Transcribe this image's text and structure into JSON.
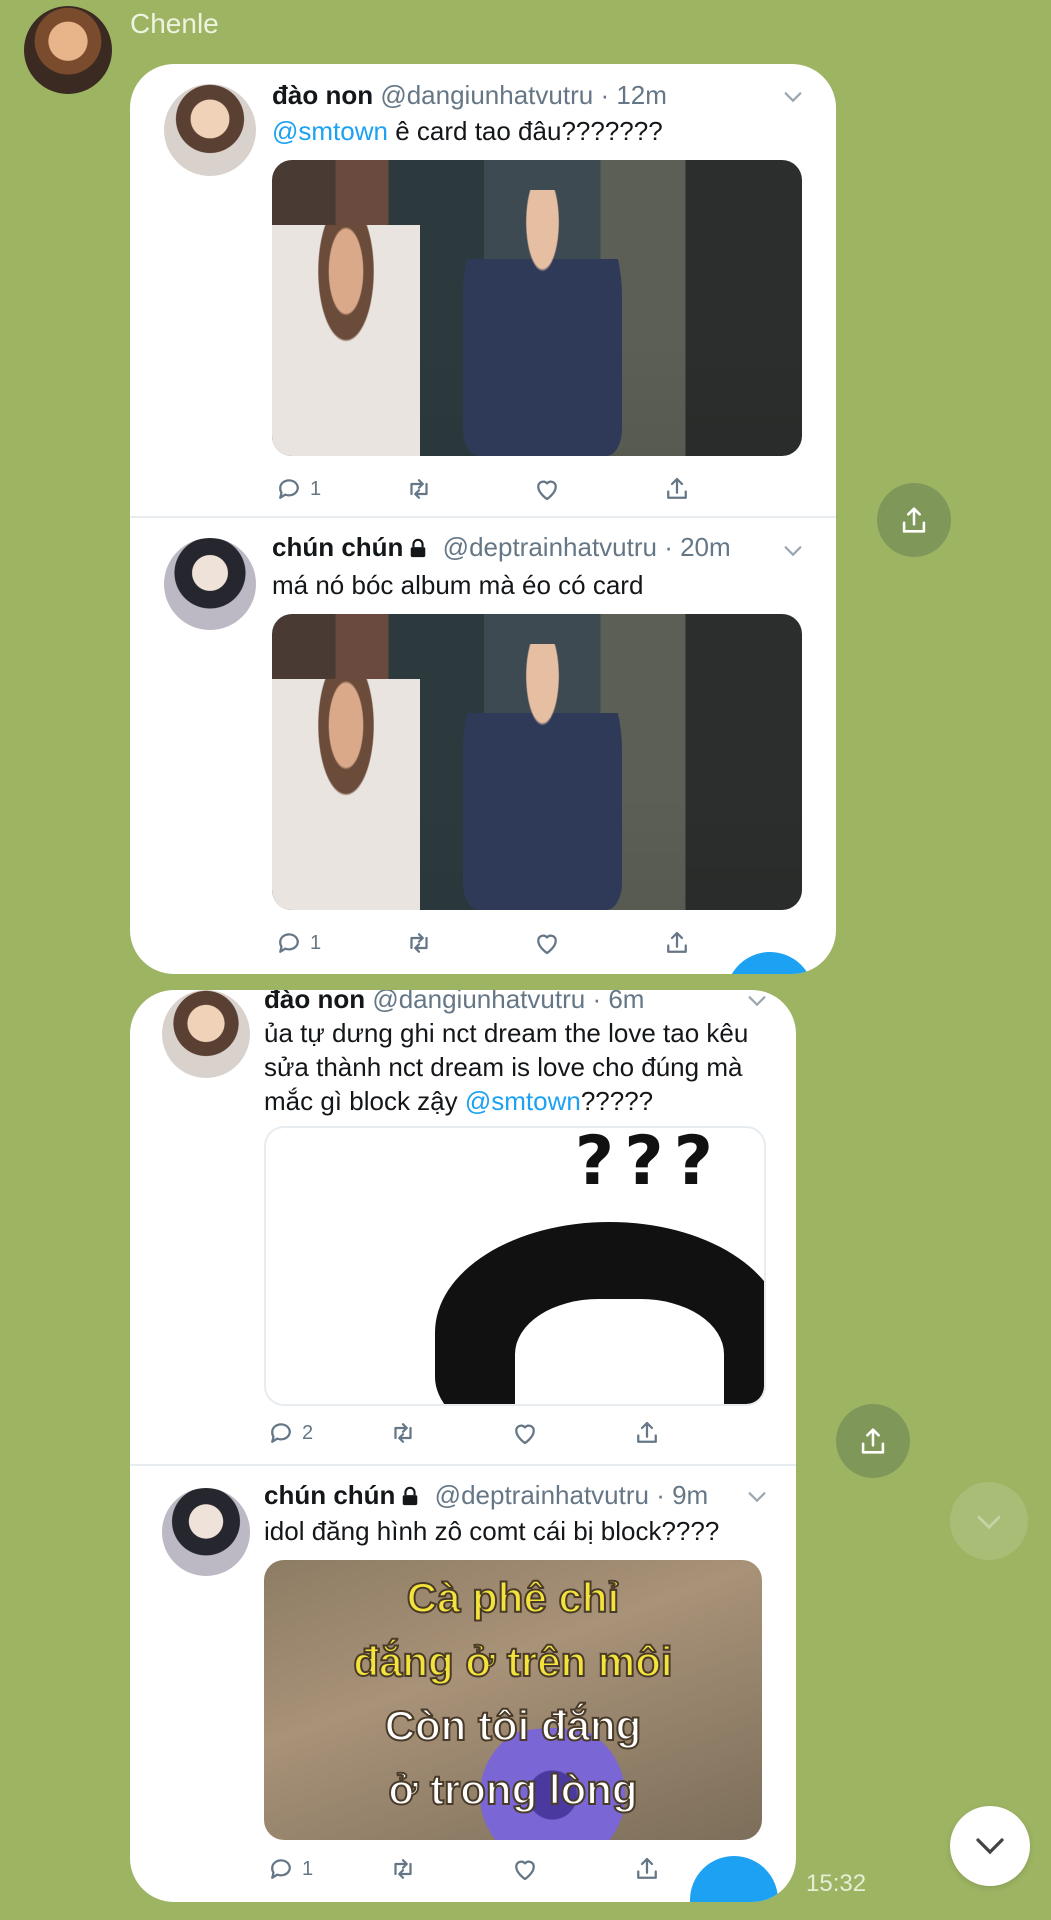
{
  "chat": {
    "sender_name": "Chenle",
    "timestamp": "15:32"
  },
  "colors": {
    "chat_background": "#9db463",
    "mention": "#1da1f2",
    "handle": "#657786",
    "share_button": "#7f985a"
  },
  "bubbles": [
    {
      "tweets": [
        {
          "name": "đào non",
          "handle": "@dangiunhatvutru",
          "time": "· 12m",
          "locked": false,
          "text_mention": "@smtown",
          "text": " ê card tao đâu???????",
          "media": "meme-photo",
          "reply_count": "1"
        },
        {
          "name": "chún chún",
          "handle": "@deptrainhatvutru",
          "time": "· 20m",
          "locked": true,
          "text": "má nó bóc album mà éo có card",
          "media": "meme-photo",
          "reply_count": "1"
        }
      ]
    },
    {
      "tweets": [
        {
          "name": "đào non",
          "handle": "@dangiunhatvutru",
          "time": "· 6m",
          "locked": false,
          "text_lines": [
            "ủa tự dưng ghi nct dream the love tao kêu",
            "sửa thành nct dream is love cho đúng mà"
          ],
          "text_line3_pre": "mắc gì block zậy ",
          "text_mention": "@smtown",
          "text_line3_post": "?????",
          "media": "cartoon-question",
          "media_text": "???",
          "reply_count": "2"
        },
        {
          "name": "chún chún",
          "handle": "@deptrainhatvutru",
          "time": "· 9m",
          "locked": true,
          "text": "idol đăng hình zô comt cái bị block????",
          "media": "caption-flower",
          "caption_lines": [
            "Cà phê chỉ",
            "đắng ở trên môi",
            "Còn tôi đắng",
            "ở trong lòng"
          ],
          "reply_count": "1"
        }
      ]
    }
  ],
  "icons": {
    "reply": "reply-icon",
    "retweet": "retweet-icon",
    "like": "heart-icon",
    "share": "share-icon",
    "chevron": "chevron-down-icon",
    "lock": "lock-icon"
  }
}
